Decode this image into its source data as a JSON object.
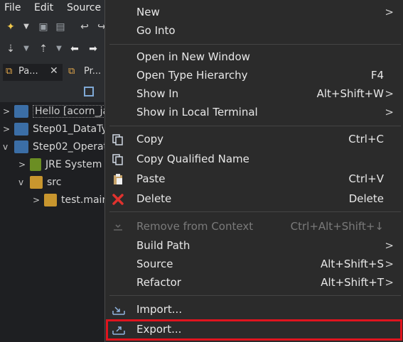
{
  "menubar": {
    "file": "File",
    "edit": "Edit",
    "source": "Source"
  },
  "tabs": [
    {
      "label": "Pa..."
    },
    {
      "label": "Pr..."
    }
  ],
  "tree": [
    {
      "label": "Hello [acorn_ja"
    },
    {
      "label": "Step01_DataTy"
    },
    {
      "label": "Step02_Operat"
    },
    {
      "label": "JRE System"
    },
    {
      "label": "src"
    },
    {
      "label": "test.main"
    }
  ],
  "menu": {
    "new": {
      "label": "New"
    },
    "go_into": {
      "label": "Go Into"
    },
    "open_window": {
      "label": "Open in New Window"
    },
    "open_type": {
      "label": "Open Type Hierarchy",
      "accel": "F4"
    },
    "show_in": {
      "label": "Show In",
      "accel": "Alt+Shift+W"
    },
    "show_terminal": {
      "label": "Show in Local Terminal"
    },
    "copy": {
      "label": "Copy",
      "accel": "Ctrl+C"
    },
    "copy_qualified": {
      "label": "Copy Qualified Name"
    },
    "paste": {
      "label": "Paste",
      "accel": "Ctrl+V"
    },
    "delete": {
      "label": "Delete",
      "accel": "Delete"
    },
    "remove_context": {
      "label": "Remove from Context",
      "accel": "Ctrl+Alt+Shift+↓"
    },
    "build_path": {
      "label": "Build Path"
    },
    "source": {
      "label": "Source",
      "accel": "Alt+Shift+S"
    },
    "refactor": {
      "label": "Refactor",
      "accel": "Alt+Shift+T"
    },
    "import": {
      "label": "Import..."
    },
    "export": {
      "label": "Export..."
    }
  },
  "colors": {
    "highlight_border": "#e0141e",
    "menu_bg": "#2b2b2b",
    "ide_bg": "#1e1f22"
  }
}
